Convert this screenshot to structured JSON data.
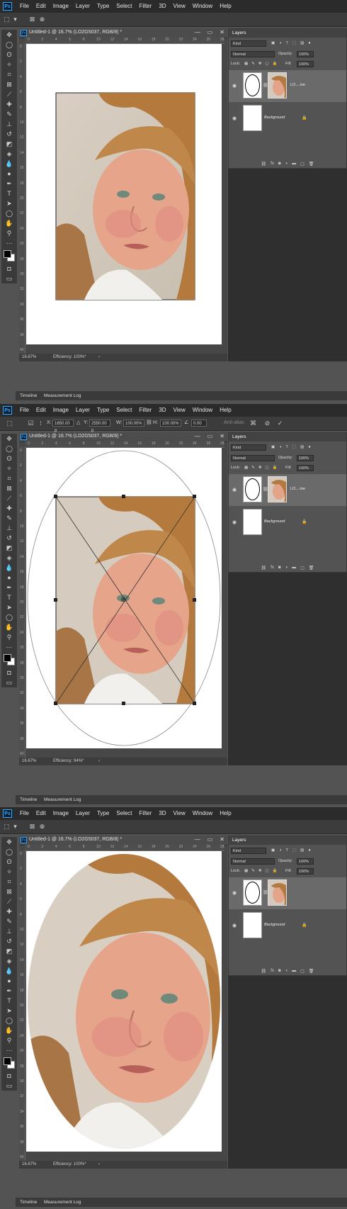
{
  "menu": {
    "items": [
      "File",
      "Edit",
      "Image",
      "Layer",
      "Type",
      "Select",
      "Filter",
      "3D",
      "View",
      "Window",
      "Help"
    ]
  },
  "document": {
    "title": "Untitled-1 @ 16.7% (LO2G5037, RGB/8) *",
    "ruler_h_ticks": [
      "0",
      "2",
      "4",
      "6",
      "8",
      "10",
      "12",
      "14",
      "16",
      "18",
      "20",
      "22",
      "24",
      "26",
      "28"
    ],
    "ruler_v_ticks": [
      "0",
      "2",
      "4",
      "6",
      "8",
      "10",
      "12",
      "14",
      "16",
      "18",
      "20",
      "22",
      "24",
      "26",
      "28",
      "30",
      "32",
      "34",
      "36",
      "38",
      "40"
    ]
  },
  "screens": [
    {
      "zoom": "16.67%",
      "efficiency": "Efficiency: 100%*"
    },
    {
      "zoom": "16.67%",
      "efficiency": "Efficiency: 94%*"
    },
    {
      "zoom": "16.67%",
      "efficiency": "Efficiency: 100%*"
    }
  ],
  "timeline": {
    "tab1": "Timeline",
    "tab2": "Measurement Log"
  },
  "transform_options": {
    "x_label": "X:",
    "x_value": "1650.00 p",
    "y_label": "Y:",
    "y_value": "2550.00 p",
    "w_label": "W:",
    "w_value": "100.00%",
    "h_label": "H:",
    "h_value": "100.00%",
    "angle_value": "0.00",
    "antialias": "Anti-alias"
  },
  "layers_panel": {
    "title": "Layers",
    "kind": "Kind",
    "blend_mode": "Normal",
    "opacity_label": "Opacity:",
    "opacity_value": "100%",
    "lock_label": "Lock:",
    "fill_label": "Fill:",
    "fill_value": "100%",
    "layers": [
      {
        "name": "LO....me",
        "type": "masked-image"
      },
      {
        "name": "Background",
        "type": "background"
      }
    ]
  },
  "colors": {
    "accent": "#31a8ff",
    "menubar": "#2b2b2b",
    "panel": "#535353",
    "canvas": "#ffffff"
  }
}
